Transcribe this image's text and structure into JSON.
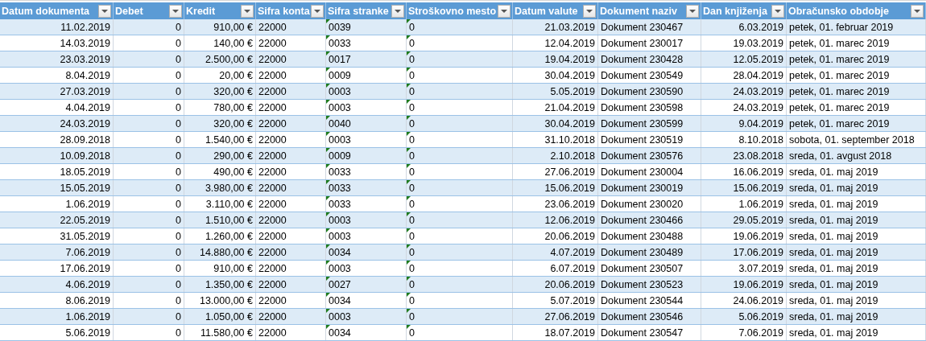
{
  "table": {
    "columns": [
      {
        "label": "Datum dokumenta",
        "kind": "number",
        "number_stored_as_text": false
      },
      {
        "label": "Debet",
        "kind": "number",
        "number_stored_as_text": false
      },
      {
        "label": "Kredit",
        "kind": "number",
        "number_stored_as_text": false
      },
      {
        "label": "Sifra konta",
        "kind": "text",
        "number_stored_as_text": false
      },
      {
        "label": "Sifra stranke",
        "kind": "text",
        "number_stored_as_text": true
      },
      {
        "label": "Stroškovno mesto",
        "kind": "text",
        "number_stored_as_text": true
      },
      {
        "label": "Datum valute",
        "kind": "number",
        "number_stored_as_text": false
      },
      {
        "label": "Dokument naziv",
        "kind": "text",
        "number_stored_as_text": false
      },
      {
        "label": "Dan knjiženja",
        "kind": "number",
        "number_stored_as_text": false
      },
      {
        "label": "Obračunsko obdobje",
        "kind": "text",
        "number_stored_as_text": false
      }
    ],
    "rows": [
      [
        "11.02.2019",
        "0",
        "910,00 €",
        "22000",
        "0039",
        "0",
        "21.03.2019",
        "Dokument 230467",
        "6.03.2019",
        "petek, 01. februar 2019"
      ],
      [
        "14.03.2019",
        "0",
        "140,00 €",
        "22000",
        "0033",
        "0",
        "12.04.2019",
        "Dokument 230017",
        "19.03.2019",
        "petek, 01. marec 2019"
      ],
      [
        "23.03.2019",
        "0",
        "2.500,00 €",
        "22000",
        "0017",
        "0",
        "19.04.2019",
        "Dokument 230428",
        "12.05.2019",
        "petek, 01. marec 2019"
      ],
      [
        "8.04.2019",
        "0",
        "20,00 €",
        "22000",
        "0009",
        "0",
        "30.04.2019",
        "Dokument 230549",
        "28.04.2019",
        "petek, 01. marec 2019"
      ],
      [
        "27.03.2019",
        "0",
        "320,00 €",
        "22000",
        "0003",
        "0",
        "5.05.2019",
        "Dokument 230590",
        "24.03.2019",
        "petek, 01. marec 2019"
      ],
      [
        "4.04.2019",
        "0",
        "780,00 €",
        "22000",
        "0003",
        "0",
        "21.04.2019",
        "Dokument 230598",
        "24.03.2019",
        "petek, 01. marec 2019"
      ],
      [
        "24.03.2019",
        "0",
        "320,00 €",
        "22000",
        "0040",
        "0",
        "30.04.2019",
        "Dokument 230599",
        "9.04.2019",
        "petek, 01. marec 2019"
      ],
      [
        "28.09.2018",
        "0",
        "1.540,00 €",
        "22000",
        "0003",
        "0",
        "31.10.2018",
        "Dokument 230519",
        "8.10.2018",
        "sobota, 01. september 2018"
      ],
      [
        "10.09.2018",
        "0",
        "290,00 €",
        "22000",
        "0009",
        "0",
        "2.10.2018",
        "Dokument 230576",
        "23.08.2018",
        "sreda, 01. avgust 2018"
      ],
      [
        "18.05.2019",
        "0",
        "490,00 €",
        "22000",
        "0033",
        "0",
        "27.06.2019",
        "Dokument 230004",
        "16.06.2019",
        "sreda, 01. maj 2019"
      ],
      [
        "15.05.2019",
        "0",
        "3.980,00 €",
        "22000",
        "0033",
        "0",
        "15.06.2019",
        "Dokument 230019",
        "15.06.2019",
        "sreda, 01. maj 2019"
      ],
      [
        "1.06.2019",
        "0",
        "3.110,00 €",
        "22000",
        "0033",
        "0",
        "23.06.2019",
        "Dokument 230020",
        "1.06.2019",
        "sreda, 01. maj 2019"
      ],
      [
        "22.05.2019",
        "0",
        "1.510,00 €",
        "22000",
        "0003",
        "0",
        "12.06.2019",
        "Dokument 230466",
        "29.05.2019",
        "sreda, 01. maj 2019"
      ],
      [
        "31.05.2019",
        "0",
        "1.260,00 €",
        "22000",
        "0003",
        "0",
        "20.06.2019",
        "Dokument 230488",
        "19.06.2019",
        "sreda, 01. maj 2019"
      ],
      [
        "7.06.2019",
        "0",
        "14.880,00 €",
        "22000",
        "0034",
        "0",
        "4.07.2019",
        "Dokument 230489",
        "17.06.2019",
        "sreda, 01. maj 2019"
      ],
      [
        "17.06.2019",
        "0",
        "910,00 €",
        "22000",
        "0003",
        "0",
        "6.07.2019",
        "Dokument 230507",
        "3.07.2019",
        "sreda, 01. maj 2019"
      ],
      [
        "4.06.2019",
        "0",
        "1.350,00 €",
        "22000",
        "0027",
        "0",
        "20.06.2019",
        "Dokument 230523",
        "19.06.2019",
        "sreda, 01. maj 2019"
      ],
      [
        "8.06.2019",
        "0",
        "13.000,00 €",
        "22000",
        "0034",
        "0",
        "5.07.2019",
        "Dokument 230544",
        "24.06.2019",
        "sreda, 01. maj 2019"
      ],
      [
        "1.06.2019",
        "0",
        "1.050,00 €",
        "22000",
        "0003",
        "0",
        "27.06.2019",
        "Dokument 230546",
        "5.06.2019",
        "sreda, 01. maj 2019"
      ],
      [
        "5.06.2019",
        "0",
        "11.580,00 €",
        "22000",
        "0034",
        "0",
        "18.07.2019",
        "Dokument 230547",
        "7.06.2019",
        "sreda, 01. maj 2019"
      ]
    ]
  }
}
